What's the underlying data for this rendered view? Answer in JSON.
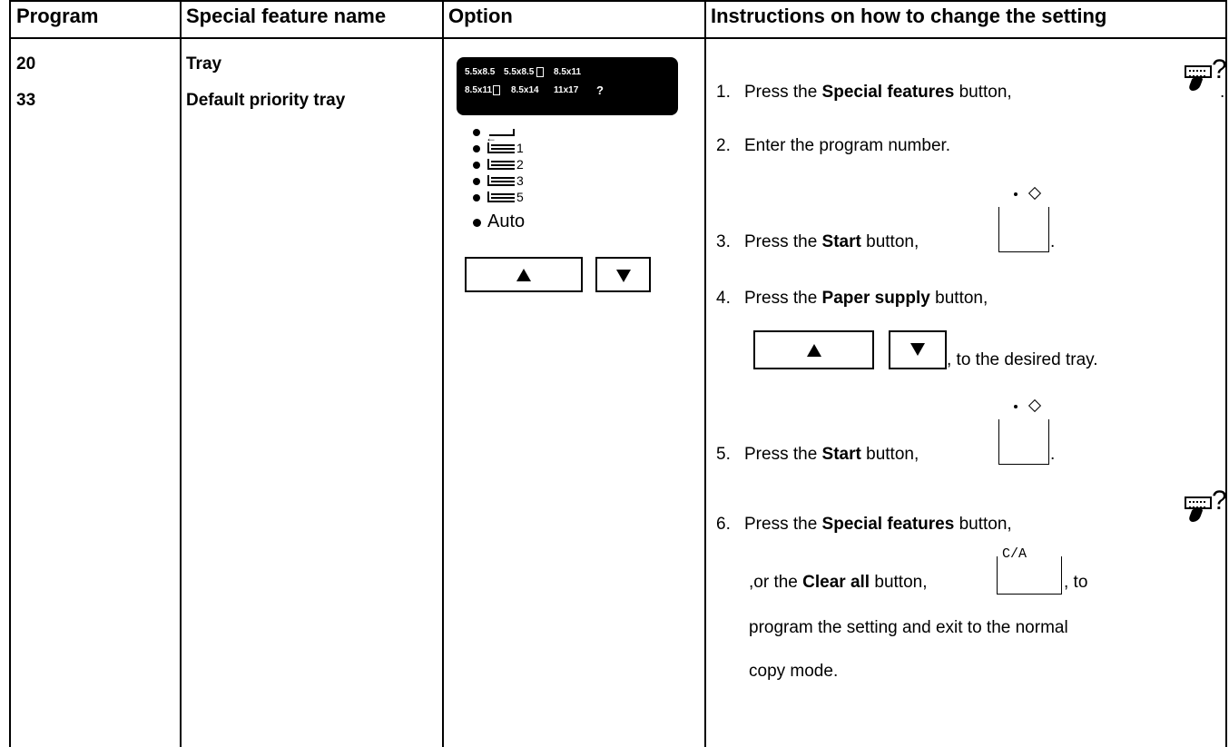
{
  "headers": {
    "program": "Program",
    "special_feature_name": "Special feature name",
    "option": "Option",
    "instructions": "Instructions on how to change the setting"
  },
  "programs": [
    {
      "number": "20",
      "name": "Tray"
    },
    {
      "number": "33",
      "name": "Default priority tray"
    }
  ],
  "panel": {
    "row1": [
      "5.5x8.5",
      "5.5x8.5",
      "8.5x11"
    ],
    "row2": [
      "8.5x11",
      "8.5x14",
      "11x17",
      "?"
    ]
  },
  "trays": [
    "1",
    "2",
    "3",
    "5"
  ],
  "auto_label": "Auto",
  "arrow_icons": [
    "arrow-up-icon",
    "arrow-down-icon"
  ],
  "instructions": {
    "s1_num": "1.",
    "s1_a": "Press the ",
    "s1_b": "Special features",
    "s1_c": " button,",
    "s1_d": ".",
    "s2_num": "2.",
    "s2_a": "Enter the program number.",
    "s3_num": "3.",
    "s3_a": "Press the ",
    "s3_b": "Start",
    "s3_c": " button,",
    "s3_d": ".",
    "s4_num": "4.",
    "s4_a": "Press the ",
    "s4_b": "Paper supply",
    "s4_c": " button,",
    "s4_d": ", to the desired tray.",
    "s5_num": "5.",
    "s5_a": "Press the ",
    "s5_b": "Start",
    "s5_c": " button,",
    "s5_d": ".",
    "s6_num": "6.",
    "s6_a": "Press the ",
    "s6_b": "Special features",
    "s6_c": " button,",
    "s6_e": ",or the ",
    "s6_f": "Clear all",
    "s6_g": " button,",
    "s6_h": ", to",
    "s6_i": "program the setting and exit to the normal",
    "s6_j": "copy mode.",
    "ca_label": "C/A"
  }
}
